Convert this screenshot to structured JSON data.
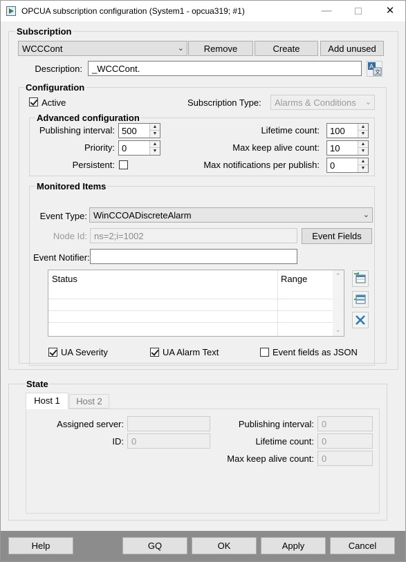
{
  "window": {
    "title": "OPCUA subscription configuration (System1 - opcua319; #1)",
    "minimize": "—",
    "close": "✕"
  },
  "subscription": {
    "group_label": "Subscription",
    "selected": "WCCCont",
    "remove_label": "Remove",
    "create_label": "Create",
    "add_unused_label": "Add unused",
    "description_label": "Description:",
    "description_value": "_WCCCont."
  },
  "configuration": {
    "group_label": "Configuration",
    "active_label": "Active",
    "active_checked": true,
    "subscription_type_label": "Subscription Type:",
    "subscription_type_value": "Alarms & Conditions",
    "advanced": {
      "group_label": "Advanced configuration",
      "publishing_interval_label": "Publishing interval:",
      "publishing_interval_value": "500",
      "priority_label": "Priority:",
      "priority_value": "0",
      "persistent_label": "Persistent:",
      "persistent_checked": false,
      "lifetime_count_label": "Lifetime count:",
      "lifetime_count_value": "100",
      "max_keep_alive_label": "Max keep alive count:",
      "max_keep_alive_value": "10",
      "max_notifications_label": "Max notifications per publish:",
      "max_notifications_value": "0"
    },
    "monitored": {
      "group_label": "Monitored Items",
      "event_type_label": "Event Type:",
      "event_type_value": "WinCCOADiscreteAlarm",
      "node_id_label": "Node Id:",
      "node_id_value": "ns=2;i=1002",
      "event_fields_label": "Event Fields",
      "event_notifier_label": "Event Notifier:",
      "event_notifier_value": "",
      "table": {
        "columns": [
          "Status",
          "Range"
        ],
        "rows": [
          [
            "",
            ""
          ],
          [
            "",
            ""
          ],
          [
            "",
            ""
          ],
          [
            "",
            ""
          ]
        ]
      },
      "ua_severity_label": "UA Severity",
      "ua_severity_checked": true,
      "ua_alarm_text_label": "UA Alarm Text",
      "ua_alarm_text_checked": true,
      "event_fields_json_label": "Event fields as JSON",
      "event_fields_json_checked": false
    }
  },
  "state": {
    "group_label": "State",
    "tabs": [
      "Host 1",
      "Host 2"
    ],
    "assigned_server_label": "Assigned server:",
    "assigned_server_value": "",
    "id_label": "ID:",
    "id_value": "0",
    "publishing_interval_label": "Publishing interval:",
    "publishing_interval_value": "0",
    "lifetime_count_label": "Lifetime count:",
    "lifetime_count_value": "0",
    "max_keep_alive_label": "Max keep alive count:",
    "max_keep_alive_value": "0"
  },
  "footer": {
    "help_label": "Help",
    "gq_label": "GQ",
    "ok_label": "OK",
    "apply_label": "Apply",
    "cancel_label": "Cancel"
  },
  "icons": {
    "app": "app-icon",
    "translate": "translate-icon",
    "add_row": "add-row-icon",
    "insert_row": "insert-row-icon",
    "delete_row": "delete-icon"
  }
}
